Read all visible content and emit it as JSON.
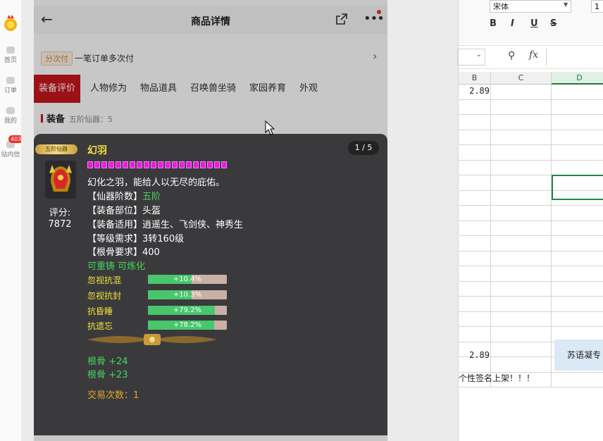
{
  "rail": {
    "items": [
      {
        "label": "首页"
      },
      {
        "label": "订单"
      },
      {
        "label": "我的"
      },
      {
        "label": "站内信",
        "badge": "403"
      }
    ]
  },
  "header": {
    "title": "商品详情",
    "back_icon": "arrow-left-icon",
    "share_icon": "share-icon",
    "more_icon": "more-dots-icon"
  },
  "paybar": {
    "tag": "分次付",
    "text": "一笔订单多次付"
  },
  "tabs": [
    {
      "label": "装备评价",
      "active": true
    },
    {
      "label": "人物修为"
    },
    {
      "label": "物品道具"
    },
    {
      "label": "召唤兽坐骑"
    },
    {
      "label": "家园养育"
    },
    {
      "label": "外观"
    }
  ],
  "equip": {
    "title": "装备",
    "subtitle": "五阶仙器：5"
  },
  "item": {
    "level_badge": "五阶仙器",
    "name": "幻羽",
    "page": "1 / 5",
    "star_count": 20,
    "score_label": "评分:",
    "score_value": "7872",
    "desc": "幻化之羽，能给人以无尽的庇佑。",
    "attrs": [
      {
        "key": "【仙器阶数】",
        "value": "五阶",
        "green": true
      },
      {
        "key": "【装备部位】",
        "value": "头盔"
      },
      {
        "key": "【装备适用】",
        "value": "逍遥生、飞剑侠、神秀生"
      },
      {
        "key": "【等级需求】",
        "value": "3转160级"
      },
      {
        "key": "【根骨要求】",
        "value": "400"
      }
    ],
    "refine": "可重铸 可炼化",
    "resists": [
      {
        "label": "忽视抗混",
        "text": "+10.4%",
        "fill": 0.55
      },
      {
        "label": "忽视抗封",
        "text": "+10.3%",
        "fill": 0.55
      },
      {
        "label": "抗昏睡",
        "text": "+79.2%",
        "fill": 0.85
      },
      {
        "label": "抗遗忘",
        "text": "+78.2%",
        "fill": 0.84
      }
    ],
    "bonuses": [
      "根骨 +24",
      "根骨 +23"
    ],
    "trade": "交易次数：1"
  },
  "sheet": {
    "font_name": "宋体",
    "font_size": "1",
    "format_buttons": [
      "B",
      "I",
      "U",
      "S"
    ],
    "columns": [
      "B",
      "C",
      "D"
    ],
    "selected_column": "D",
    "cells": {
      "b1": "2.89",
      "b_last": "2.89",
      "merged_text": "苏语凝专",
      "signature_row": "个性签名上架！！！"
    }
  },
  "colors": {
    "accent_red": "#c8161d",
    "name_yellow": "#f2e23b",
    "attr_green": "#46d658",
    "bar_green": "#48c66b",
    "trade_orange": "#e6a423",
    "star_magenta": "#e020d8",
    "excel_green": "#1d8a43"
  }
}
